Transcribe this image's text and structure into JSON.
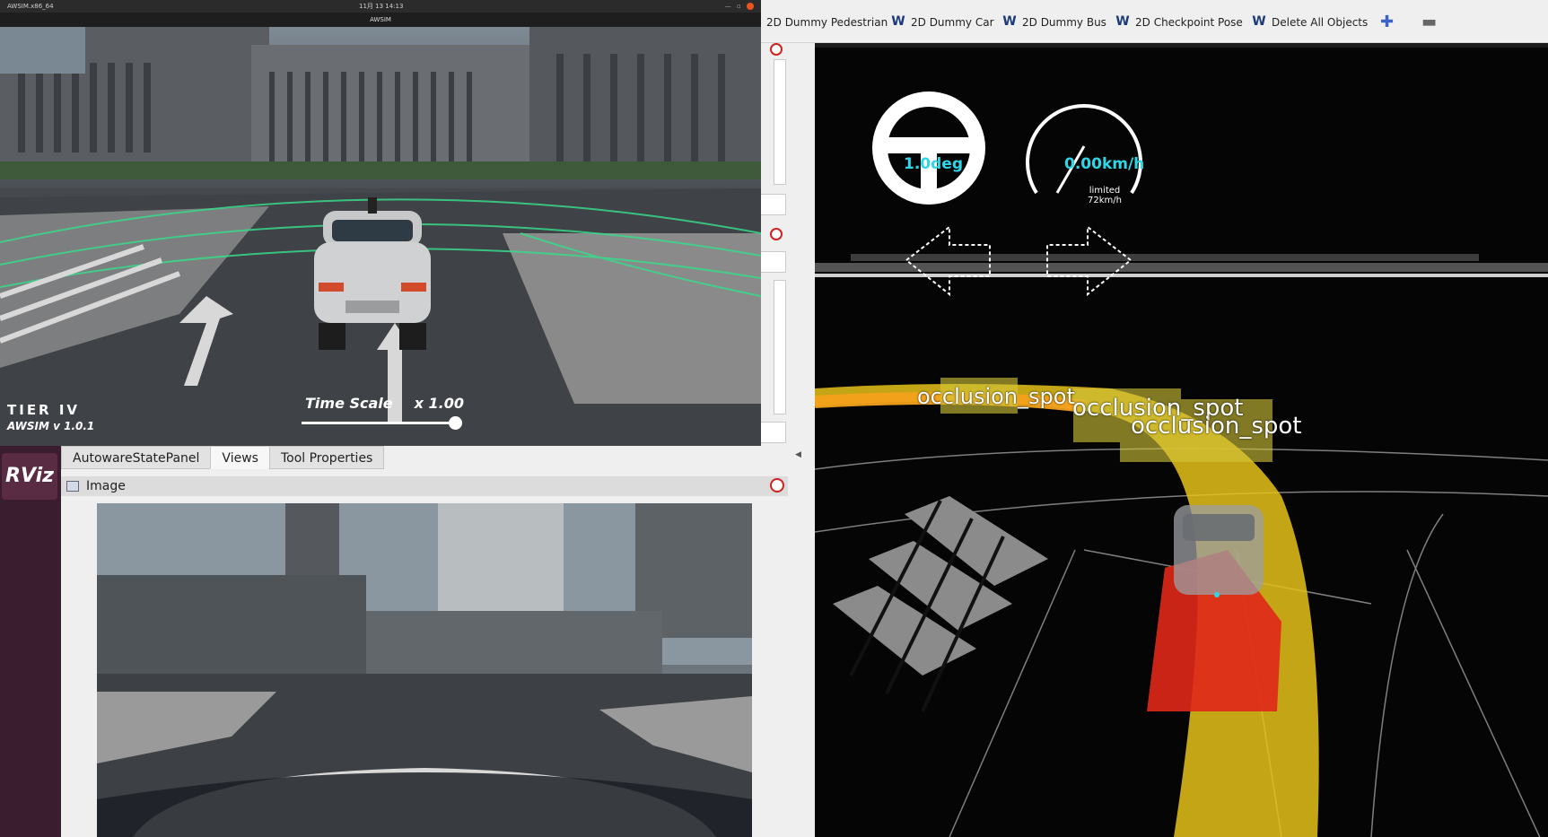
{
  "awsim": {
    "window_label": "AWSIM.x86_64",
    "clock": "11月 13 14:13",
    "title": "AWSIM",
    "brand": "TIER IV",
    "version": "AWSIM v 1.0.1",
    "time_scale_label": "Time Scale",
    "time_scale_value": "x 1.00",
    "time_scale_level": 1.0
  },
  "toolbar": {
    "tools": [
      {
        "label": "2D Dummy Pedestrian",
        "icon": "autoware-icon"
      },
      {
        "label": "2D Dummy Car",
        "icon": "autoware-icon"
      },
      {
        "label": "2D Dummy Bus",
        "icon": "autoware-icon"
      },
      {
        "label": "2D Checkpoint Pose",
        "icon": "autoware-icon"
      },
      {
        "label": "Delete All Objects",
        "icon": "autoware-icon"
      }
    ],
    "add_icon": "plus-icon",
    "remove_icon": "minus-icon"
  },
  "dock": {
    "logo": "RViz",
    "tabs": [
      "AutowareStatePanel",
      "Views",
      "Tool Properties"
    ],
    "active_tab": "Views",
    "image_panel_title": "Image"
  },
  "view3d": {
    "steering": "1.0deg",
    "speed": "0.00km/h",
    "limit_line1": "limited",
    "limit_line2": "72km/h",
    "labels": [
      "occlusion_spot",
      "occlusion_spot",
      "occlusion_spot"
    ]
  },
  "colors": {
    "readout": "#2fd6e6",
    "path_red": "#e0281a",
    "path_yellow": "#e6d21a",
    "close_red": "#d02020"
  }
}
